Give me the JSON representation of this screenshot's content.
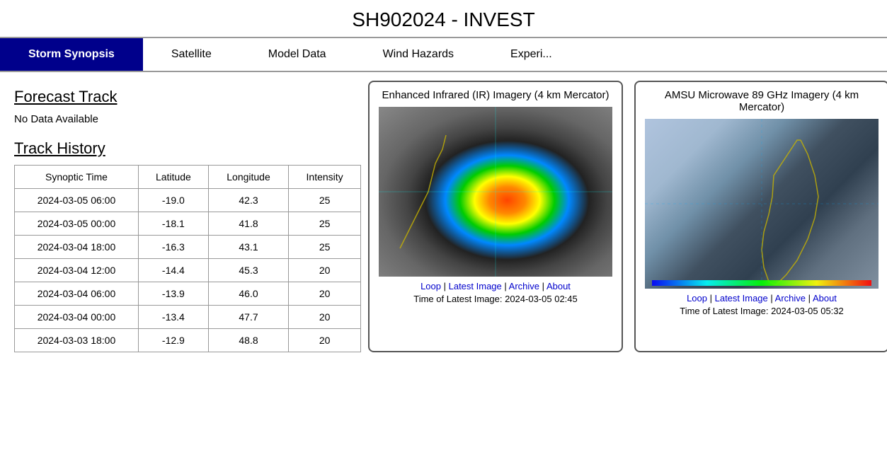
{
  "header": {
    "title": "SH902024 - INVEST"
  },
  "nav": {
    "tabs": [
      {
        "label": "Storm Synopsis",
        "active": true
      },
      {
        "label": "Satellite",
        "active": false
      },
      {
        "label": "Model Data",
        "active": false
      },
      {
        "label": "Wind Hazards",
        "active": false
      },
      {
        "label": "Experi...",
        "active": false
      }
    ]
  },
  "left_panel": {
    "forecast_track_title": "Forecast Track",
    "no_data_text": "No Data Available",
    "track_history_title": "Track History",
    "table": {
      "headers": [
        "Synoptic Time",
        "Latitude",
        "Longitude",
        "Intensity"
      ],
      "rows": [
        [
          "2024-03-05 06:00",
          "-19.0",
          "42.3",
          "25"
        ],
        [
          "2024-03-05 00:00",
          "-18.1",
          "41.8",
          "25"
        ],
        [
          "2024-03-04 18:00",
          "-16.3",
          "43.1",
          "25"
        ],
        [
          "2024-03-04 12:00",
          "-14.4",
          "45.3",
          "20"
        ],
        [
          "2024-03-04 06:00",
          "-13.9",
          "46.0",
          "20"
        ],
        [
          "2024-03-04 00:00",
          "-13.4",
          "47.7",
          "20"
        ],
        [
          "2024-03-03 18:00",
          "-12.9",
          "48.8",
          "20"
        ]
      ]
    }
  },
  "panels": {
    "ir": {
      "title": "Enhanced Infrared (IR) Imagery (4 km Mercator)",
      "links": {
        "loop": "Loop",
        "latest_image": "Latest Image",
        "archive": "Archive",
        "about": "About"
      },
      "time_label": "Time of Latest Image: 2024-03-05 02:45"
    },
    "microwave": {
      "title": "AMSU Microwave 89 GHz Imagery (4 km Mercator)",
      "links": {
        "loop": "Loop",
        "latest_image": "Latest Image",
        "archive": "Archive",
        "about": "About"
      },
      "time_label": "Time of Latest Image: 2024-03-05 05:32"
    }
  }
}
